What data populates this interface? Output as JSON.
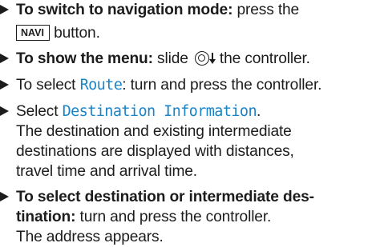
{
  "steps": [
    {
      "lead": "To switch to navigation mode:",
      "text": " press the",
      "line2_key": "NAVI",
      "line2_text": " button."
    },
    {
      "lead": "To show the menu:",
      "text_before_icon": " slide ",
      "icon": "controller-slide-down-icon",
      "text_after_icon": "the controller."
    },
    {
      "text_before": "To select ",
      "menu_item": "Route",
      "text_after": ": turn and press the controller."
    },
    {
      "text_before": "Select ",
      "menu_item": "Destination Information",
      "text_after": ".",
      "description": [
        "The destination and existing intermediate",
        "destinations are displayed with distances,",
        "travel time and arrival time."
      ]
    },
    {
      "lead_line1": "To select destination or intermediate des-",
      "lead_line2": "tination:",
      "text": " turn and press the controller.",
      "result": "The address appears."
    }
  ],
  "colors": {
    "text": "#1c1c1c",
    "menu_item": "#1a84c8"
  }
}
